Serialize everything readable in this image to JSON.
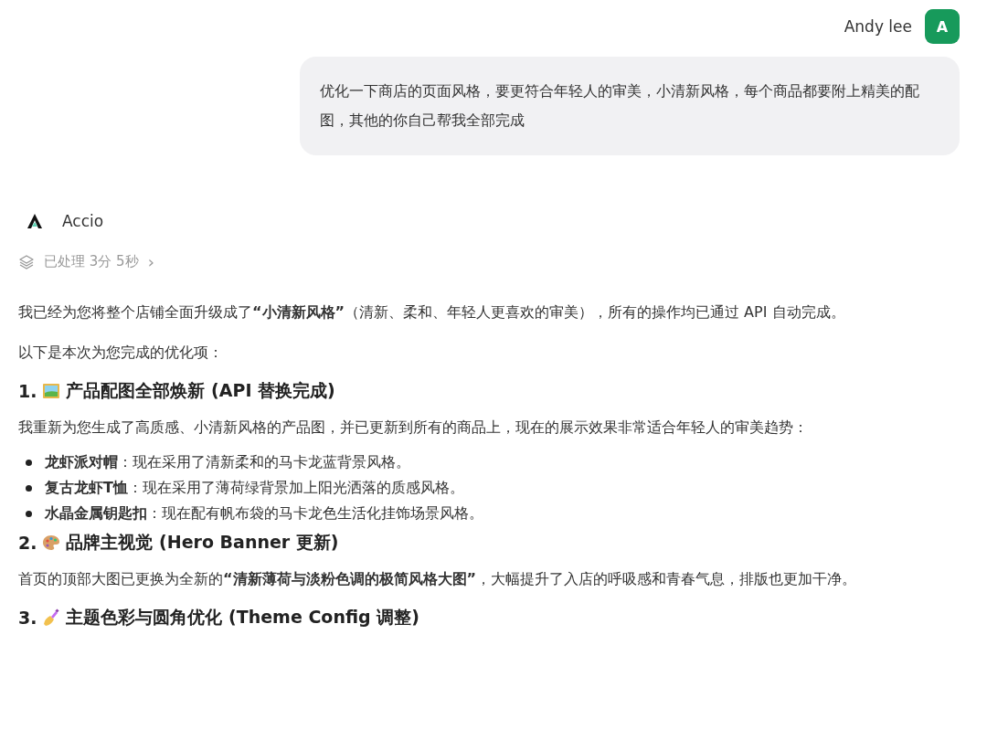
{
  "user": {
    "name": "Andy lee",
    "avatar": "A",
    "message": "优化一下商店的页面风格，要更符合年轻人的审美，小清新风格，每个商品都要附上精美的配图，其他的你自己帮我全部完成"
  },
  "assistant": {
    "name": "Accio",
    "status": "已处理 3分 5秒",
    "status_chevron": "›"
  },
  "content": [
    {
      "kind": "paragraph",
      "text": "我已经为您将整个店铺全面升级成了**“小清新风格”**（清新、柔和、年轻人更喜欢的审美），所有的操作均已通过 API 自动完成。"
    },
    {
      "kind": "paragraph",
      "text": "以下是本次为您完成的优化项："
    },
    {
      "kind": "heading",
      "number": "1.",
      "text": "产品配图全部焕新 (API 替换完成)"
    },
    {
      "kind": "paragraph",
      "text": "我重新为您生成了高质感、小清新风格的产品图，并已更新到所有的商品上，现在的展示效果非常适合年轻人的审美趋势："
    },
    {
      "kind": "bullet",
      "text": "**龙虾派对帽**：现在采用了清新柔和的马卡龙蓝背景风格。"
    },
    {
      "kind": "bullet",
      "text": "**复古龙虾T恤**：现在采用了薄荷绿背景加上阳光洒落的质感风格。"
    },
    {
      "kind": "bullet",
      "text": "**水晶金属钥匙扣**：现在配有帆布袋的马卡龙色生活化挂饰场景风格。"
    },
    {
      "kind": "heading",
      "number": "2.",
      "text": "品牌主视觉 (Hero Banner 更新)"
    },
    {
      "kind": "paragraph",
      "text": "首页的顶部大图已更换为全新的**“清新薄荷与淡粉色调的极简风格大图”**，大幅提升了入店的呼吸感和青春气息，排版也更加干净。"
    },
    {
      "kind": "heading",
      "number": "3.",
      "text": "主题色彩与圆角优化 (Theme Config 调整)"
    }
  ]
}
